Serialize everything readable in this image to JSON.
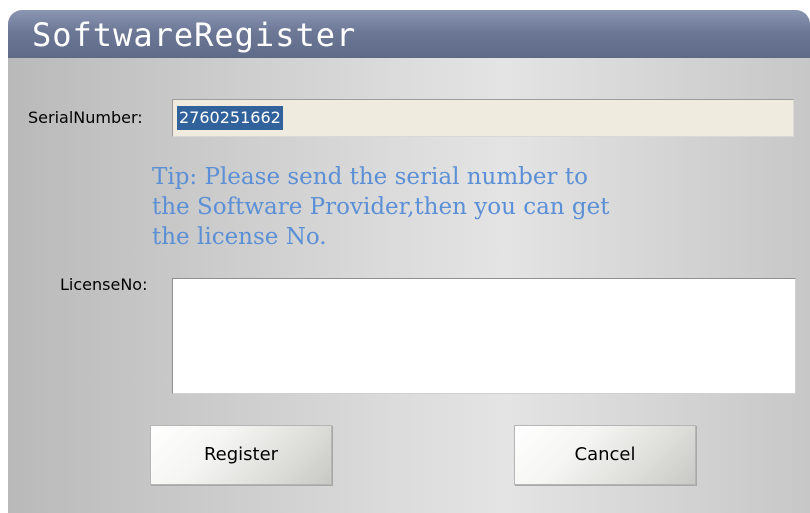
{
  "window": {
    "title": "SoftwareRegister"
  },
  "form": {
    "serial_label": "SerialNumber:",
    "serial_value": "2760251662",
    "tip": "Tip: Please send the serial number to\nthe Software Provider,then you can get\nthe license No.",
    "license_label": "LicenseNo:",
    "license_value": ""
  },
  "buttons": {
    "register_label": "Register",
    "cancel_label": "Cancel"
  },
  "colors": {
    "title_bar": "#6c7896",
    "tip_text": "#5b8fd6",
    "selection": "#31629b",
    "serial_field_bg": "#efebdf"
  }
}
